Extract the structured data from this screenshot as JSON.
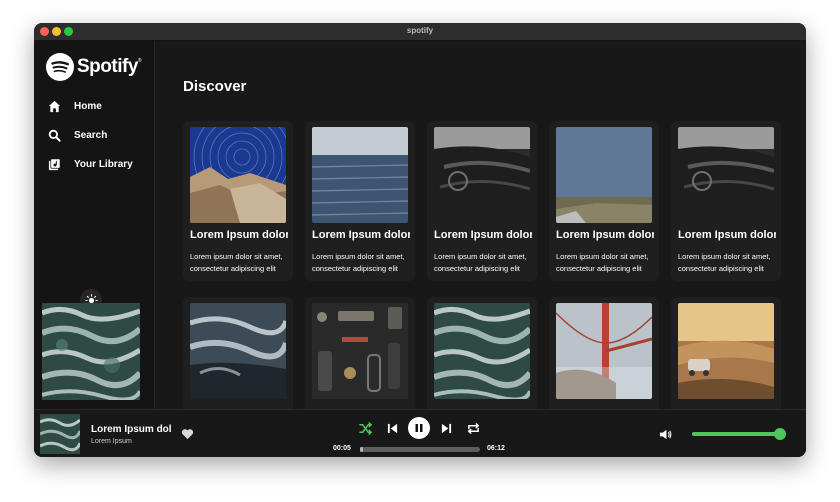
{
  "window": {
    "title": "spotify"
  },
  "brand": {
    "name": "Spotify",
    "trademark": "®"
  },
  "sidebar": {
    "nav": [
      {
        "label": "Home",
        "icon": "home-icon"
      },
      {
        "label": "Search",
        "icon": "search-icon"
      },
      {
        "label": "Your Library",
        "icon": "library-icon"
      }
    ],
    "theme_toggle_icon": "sun-icon",
    "art_image": "ocean-waves-art"
  },
  "main": {
    "heading": "Discover",
    "cards": [
      {
        "title": "Lorem Ipsum dolor sit",
        "description": "Lorem ipsum dolor sit amet, consectetur adipiscing elit",
        "image": "star-trails-rocks"
      },
      {
        "title": "Lorem Ipsum dolor sit",
        "description": "Lorem ipsum dolor sit amet, consectetur adipiscing elit",
        "image": "sea-horizon"
      },
      {
        "title": "Lorem Ipsum dolor sit",
        "description": "Lorem ipsum dolor sit amet, consectetur adipiscing elit",
        "image": "vintage-car-interior"
      },
      {
        "title": "Lorem Ipsum dolor sit",
        "description": "Lorem ipsum dolor sit amet, consectetur adipiscing elit",
        "image": "blue-sky-field"
      },
      {
        "title": "Lorem Ipsum dolor sit",
        "description": "Lorem ipsum dolor sit amet, consectetur adipiscing elit",
        "image": "vintage-car-interior"
      },
      {
        "title": "",
        "description": "",
        "image": "ocean-waves-rocks"
      },
      {
        "title": "",
        "description": "",
        "image": "flatlay-accessories"
      },
      {
        "title": "",
        "description": "",
        "image": "ocean-waves-art"
      },
      {
        "title": "",
        "description": "",
        "image": "golden-gate-fog"
      },
      {
        "title": "",
        "description": "",
        "image": "dusty-road-car"
      }
    ]
  },
  "player": {
    "track_title": "Lorem Ipsum dolor sit",
    "artist": "Lorem Ipsum",
    "elapsed": "00:05",
    "duration": "06:12",
    "progress_fraction": 0.013,
    "volume_fraction": 0.98,
    "accent_color": "#4fc55d",
    "controls": [
      "shuffle-icon",
      "previous-icon",
      "pause-icon",
      "next-icon",
      "repeat-icon"
    ]
  }
}
